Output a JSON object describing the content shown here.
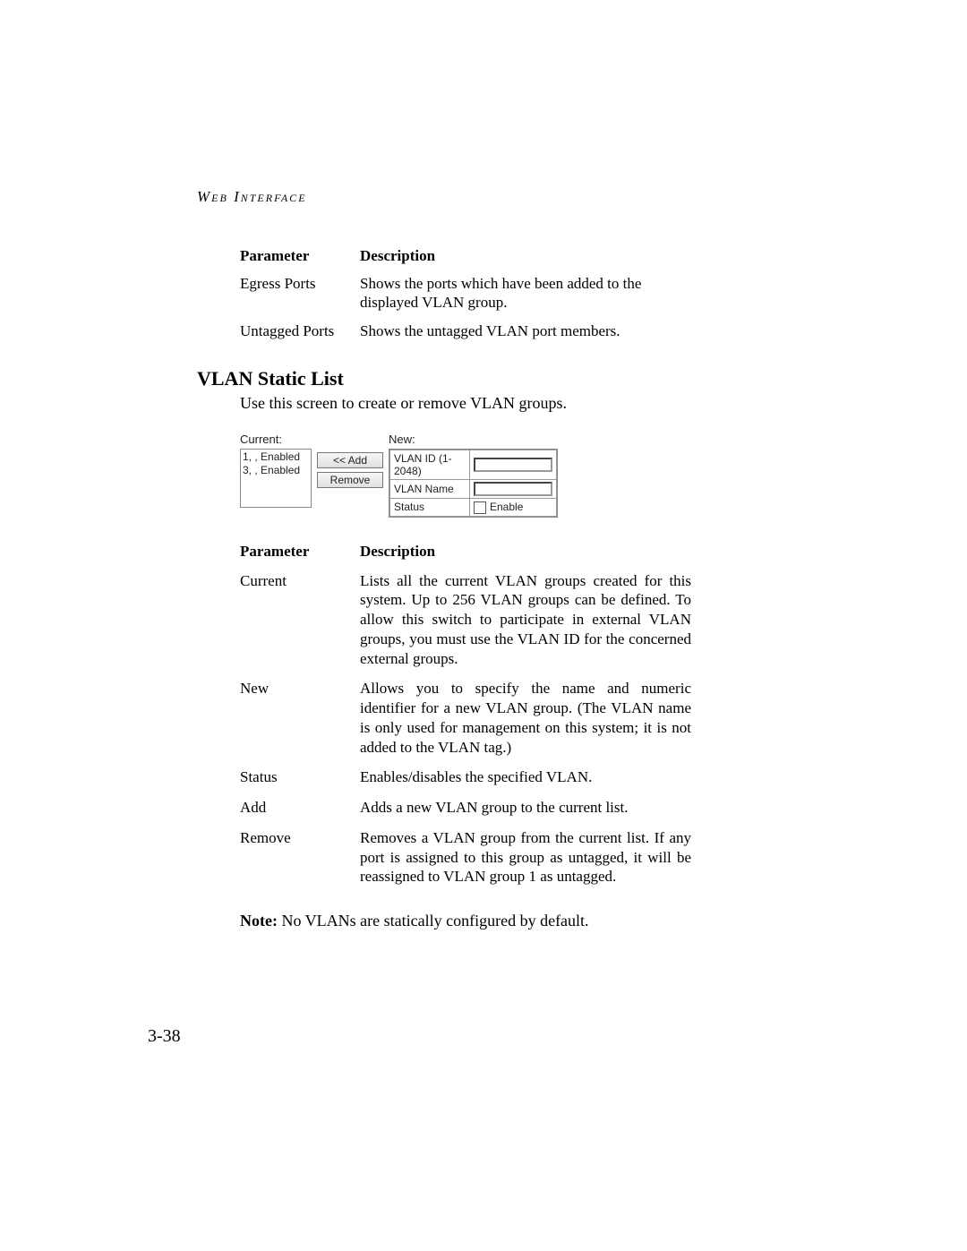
{
  "running_head": "Web Interface",
  "table1": {
    "h_param": "Parameter",
    "h_desc": "Description",
    "rows": [
      {
        "param": "Egress Ports",
        "desc": "Shows the ports which have been added to the displayed VLAN group."
      },
      {
        "param": "Untagged Ports",
        "desc": "Shows the untagged VLAN port members."
      }
    ]
  },
  "section_title": "VLAN Static List",
  "section_intro": "Use this screen to create or remove VLAN groups.",
  "ui": {
    "current_label": "Current:",
    "current_items": [
      "1, , Enabled",
      "3, , Enabled"
    ],
    "add_btn": "<< Add",
    "remove_btn": "Remove",
    "new_label": "New:",
    "rows": {
      "vlan_id": "VLAN ID (1-2048)",
      "vlan_name": "VLAN Name",
      "status": "Status",
      "enable": "Enable"
    }
  },
  "table2": {
    "h_param": "Parameter",
    "h_desc": "Description",
    "rows": [
      {
        "param": "Current",
        "desc": "Lists all the current VLAN groups created for this system. Up to 256 VLAN groups can be defined. To allow this switch to participate in external VLAN groups, you must use the VLAN ID for the concerned external groups."
      },
      {
        "param": "New",
        "desc": "Allows you to specify the name and numeric identifier for a new VLAN group. (The VLAN name is only used for management on this system; it is not added to the VLAN tag.)"
      },
      {
        "param": "Status",
        "desc": "Enables/disables the specified VLAN."
      },
      {
        "param": "Add",
        "desc": "Adds a new VLAN group to the current list."
      },
      {
        "param": "Remove",
        "desc": "Removes a VLAN group from the current list. If any port is assigned to this group as untagged, it will be reassigned to VLAN group 1 as untagged."
      }
    ]
  },
  "note_label": "Note:",
  "note_text": "No VLANs are statically configured by default.",
  "page_number": "3-38"
}
